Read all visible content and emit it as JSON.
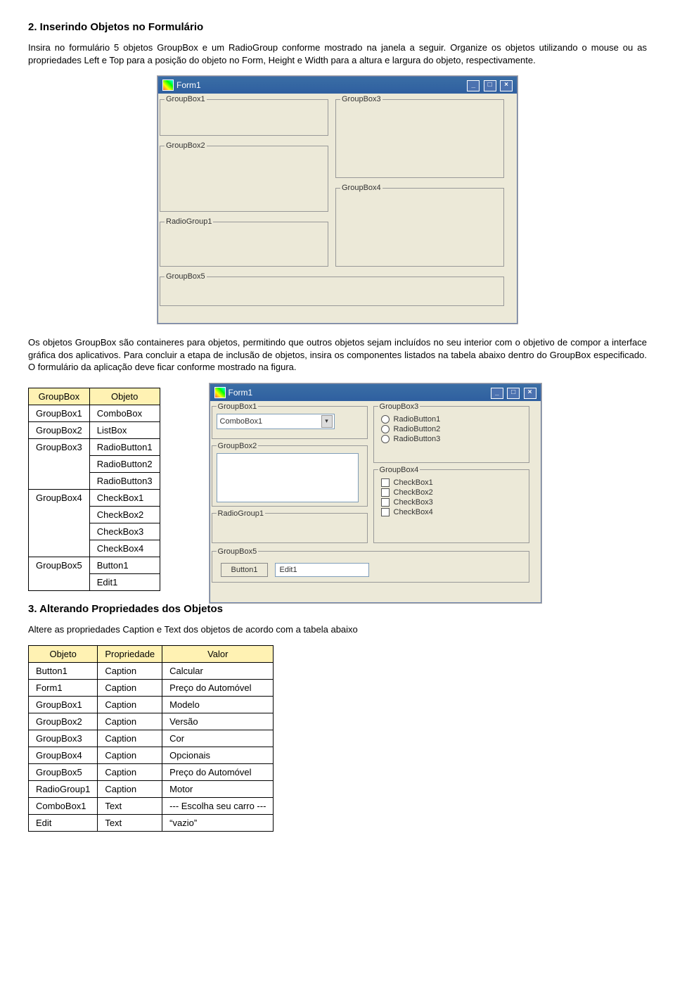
{
  "section1": {
    "heading": "2. Inserindo Objetos no Formulário",
    "p1": "Insira no formulário 5 objetos GroupBox e um RadioGroup conforme mostrado na janela a seguir. Organize os objetos utilizando o mouse ou as propriedades Left e Top para a posição do objeto no Form, Height e Width para a altura e largura do objeto, respectivamente."
  },
  "form1": {
    "title": "Form1",
    "gb1": "GroupBox1",
    "gb2": "GroupBox2",
    "gb3": "GroupBox3",
    "gb4": "GroupBox4",
    "gb5": "GroupBox5",
    "rg1": "RadioGroup1",
    "min": "_",
    "max": "□",
    "close": "×"
  },
  "section2": {
    "p2": "Os objetos GroupBox são containeres para objetos, permitindo que outros objetos sejam incluídos no seu interior com o objetivo de compor a interface gráfica dos aplicativos. Para concluir a etapa de inclusão de objetos, insira os componentes listados na tabela abaixo dentro do GroupBox especificado. O formulário da aplicação deve ficar conforme mostrado na figura."
  },
  "table1": {
    "h1": "GroupBox",
    "h2": "Objeto",
    "rows": [
      {
        "a": "GroupBox1",
        "b": "ComboBox"
      },
      {
        "a": "GroupBox2",
        "b": "ListBox"
      },
      {
        "a": "GroupBox3",
        "b": "RadioButton1"
      },
      {
        "a": "",
        "b": "RadioButton2"
      },
      {
        "a": "",
        "b": "RadioButton3"
      },
      {
        "a": "GroupBox4",
        "b": "CheckBox1"
      },
      {
        "a": "",
        "b": "CheckBox2"
      },
      {
        "a": "",
        "b": "CheckBox3"
      },
      {
        "a": "",
        "b": "CheckBox4"
      },
      {
        "a": "GroupBox5",
        "b": "Button1"
      },
      {
        "a": "",
        "b": "Edit1"
      }
    ]
  },
  "form2": {
    "title": "Form1",
    "combobox": "ComboBox1",
    "rb1": "RadioButton1",
    "rb2": "RadioButton2",
    "rb3": "RadioButton3",
    "cb1": "CheckBox1",
    "cb2": "CheckBox2",
    "cb3": "CheckBox3",
    "cb4": "CheckBox4",
    "button1": "Button1",
    "edit1": "Edit1"
  },
  "section3": {
    "heading": "3. Alterando Propriedades dos Objetos",
    "p3": "Altere as propriedades Caption e Text dos objetos de acordo com a tabela abaixo"
  },
  "table2": {
    "h1": "Objeto",
    "h2": "Propriedade",
    "h3": "Valor",
    "rows": [
      {
        "a": "Button1",
        "b": "Caption",
        "c": "Calcular"
      },
      {
        "a": "Form1",
        "b": "Caption",
        "c": "Preço do Automóvel"
      },
      {
        "a": "GroupBox1",
        "b": "Caption",
        "c": "Modelo"
      },
      {
        "a": "GroupBox2",
        "b": "Caption",
        "c": "Versão"
      },
      {
        "a": "GroupBox3",
        "b": "Caption",
        "c": "Cor"
      },
      {
        "a": "GroupBox4",
        "b": "Caption",
        "c": "Opcionais"
      },
      {
        "a": "GroupBox5",
        "b": "Caption",
        "c": "Preço do Automóvel"
      },
      {
        "a": "RadioGroup1",
        "b": "Caption",
        "c": "Motor"
      },
      {
        "a": "ComboBox1",
        "b": "Text",
        "c": "--- Escolha seu carro ---"
      },
      {
        "a": "Edit",
        "b": "Text",
        "c": "“vazio”"
      }
    ]
  }
}
